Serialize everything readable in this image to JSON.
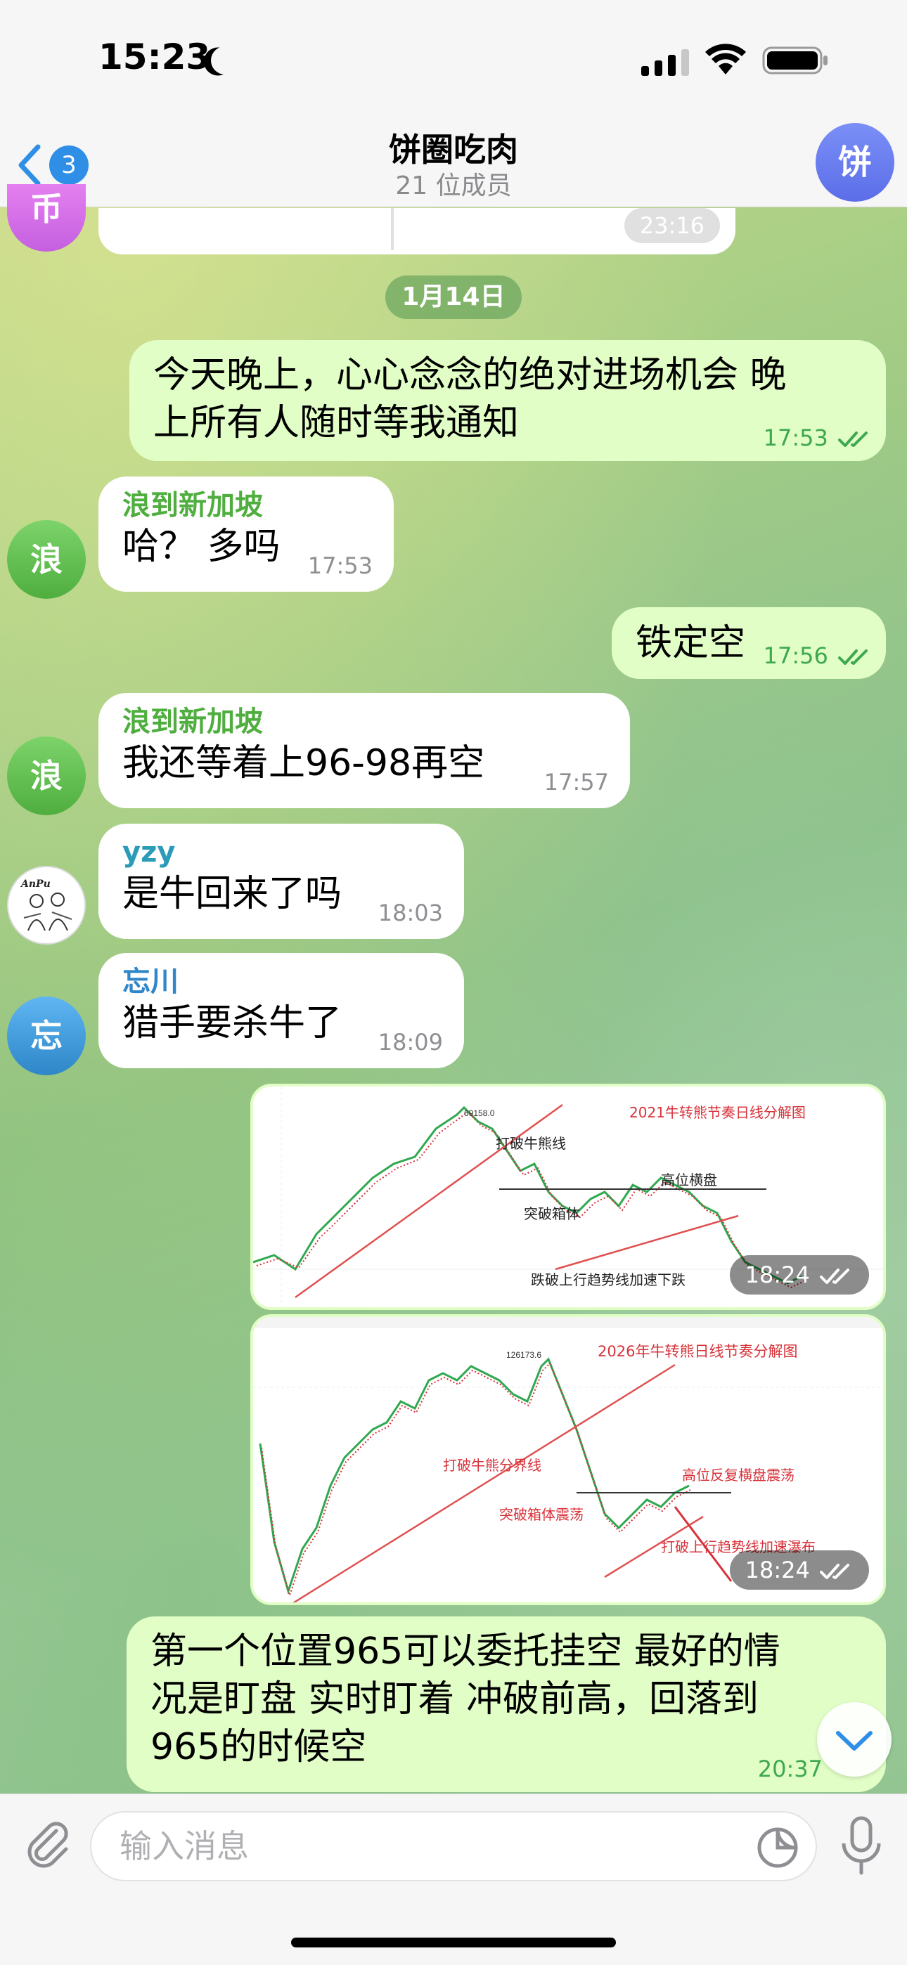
{
  "status_bar": {
    "time": "15:23"
  },
  "header": {
    "unread_count": "3",
    "title": "饼圈吃肉",
    "subtitle": "21 位成员",
    "avatar_letter": "饼"
  },
  "top_partial": {
    "avatar_letter": "币",
    "time": "23:16"
  },
  "date_separator": "1月14日",
  "messages": [
    {
      "direction": "out",
      "lines": [
        "今天晚上，心心念念的绝对进场机会 晚",
        "上所有人随时等我通知"
      ],
      "time": "17:53"
    },
    {
      "direction": "in",
      "sender": "浪到新加坡",
      "avatar_letter": "浪",
      "text": "哈？ 多吗",
      "time": "17:53"
    },
    {
      "direction": "out",
      "text": "铁定空",
      "time": "17:56"
    },
    {
      "direction": "in",
      "sender": "浪到新加坡",
      "avatar_letter": "浪",
      "text": "我还等着上96-98再空",
      "time": "17:57"
    },
    {
      "direction": "in",
      "sender": "yzy",
      "avatar_letter": "AnPu",
      "text": "是牛回来了吗",
      "time": "18:03"
    },
    {
      "direction": "in",
      "sender": "忘川",
      "avatar_letter": "忘",
      "text": "猎手要杀牛了",
      "time": "18:09"
    },
    {
      "direction": "out",
      "type": "image",
      "time": "18:24",
      "labels": {
        "title": "2021牛转熊节奏日线分解图",
        "peak": "69158.0",
        "a": "打破牛熊线",
        "b": "高位横盘",
        "c": "突破箱体",
        "d": "跌破上行趋势线加速下跌"
      }
    },
    {
      "direction": "out",
      "type": "image",
      "time": "18:24",
      "labels": {
        "title": "2026年牛转熊日线节奏分解图",
        "peak": "126173.6",
        "a": "打破牛熊分界线",
        "b": "高位反复横盘震荡",
        "c": "突破箱体震荡",
        "d": "打破上行趋势线加速瀑布"
      }
    },
    {
      "direction": "out",
      "lines": [
        "第一个位置965可以委托挂空  最好的情",
        "况是盯盘 实时盯着 冲破前高，回落到",
        "965的时候空"
      ],
      "time": "20:37"
    }
  ],
  "input": {
    "placeholder": "输入消息"
  },
  "colors": {
    "out_bubble": "#e1fec6",
    "in_bubble": "#ffffff",
    "sender_green": "#4fae3f",
    "sender_teal": "#2a9bb8",
    "sender_blue": "#2f86c8",
    "accent_blue": "#2f8fe6"
  },
  "icons": [
    "moon-icon",
    "signal-icon",
    "wifi-icon",
    "battery-icon",
    "back-chevron-icon",
    "double-check-icon",
    "paperclip-icon",
    "sticker-icon",
    "microphone-icon",
    "chevron-down-icon"
  ]
}
